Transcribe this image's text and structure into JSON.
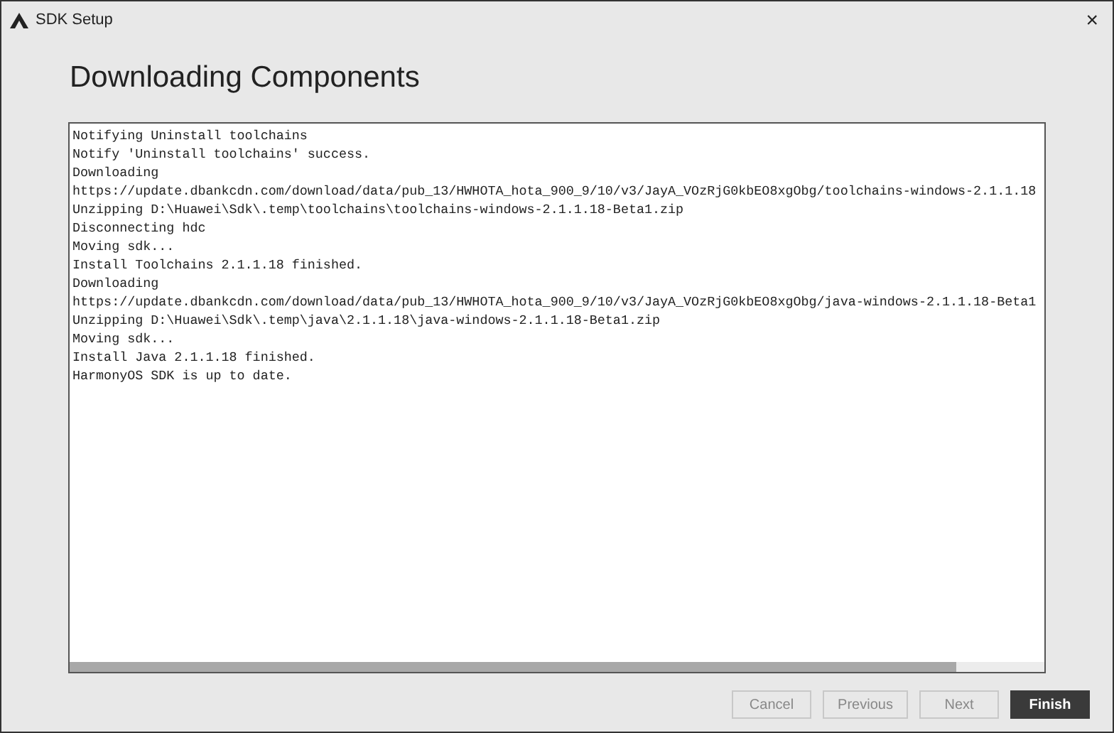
{
  "window": {
    "title": "SDK Setup",
    "close": "×"
  },
  "heading": "Downloading Components",
  "log": [
    "Notifying Uninstall toolchains",
    "Notify 'Uninstall toolchains' success.",
    "Downloading",
    "https://update.dbankcdn.com/download/data/pub_13/HWHOTA_hota_900_9/10/v3/JayA_VOzRjG0kbEO8xgObg/toolchains-windows-2.1.1.18",
    "Unzipping D:\\Huawei\\Sdk\\.temp\\toolchains\\toolchains-windows-2.1.1.18-Beta1.zip",
    "Disconnecting hdc",
    "Moving sdk...",
    "Install Toolchains 2.1.1.18 finished.",
    "Downloading",
    "https://update.dbankcdn.com/download/data/pub_13/HWHOTA_hota_900_9/10/v3/JayA_VOzRjG0kbEO8xgObg/java-windows-2.1.1.18-Beta1",
    "Unzipping D:\\Huawei\\Sdk\\.temp\\java\\2.1.1.18\\java-windows-2.1.1.18-Beta1.zip",
    "Moving sdk...",
    "Install Java 2.1.1.18 finished.",
    "HarmonyOS SDK is up to date."
  ],
  "buttons": [
    {
      "label": "Cancel",
      "disabled": true,
      "primary": false
    },
    {
      "label": "Previous",
      "disabled": true,
      "primary": false
    },
    {
      "label": "Next",
      "disabled": true,
      "primary": false
    },
    {
      "label": "Finish",
      "disabled": false,
      "primary": true
    }
  ]
}
